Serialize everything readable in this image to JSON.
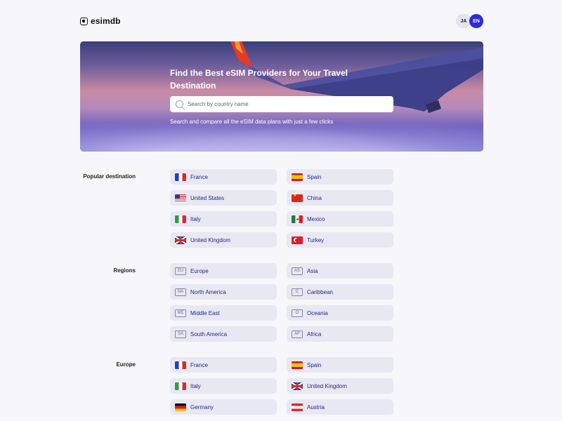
{
  "header": {
    "logo_text": "esimdb",
    "lang_options": [
      "JA",
      "EN"
    ],
    "active_lang": "EN"
  },
  "hero": {
    "title": "Find the Best eSIM Providers for Your Travel Destination",
    "search_placeholder": "Search by country name",
    "subtitle": "Search and compare all the eSIM data plans with just a few clicks"
  },
  "sections": {
    "popular": {
      "label": "Popular destination",
      "items": [
        {
          "label": "France",
          "icon": "flag-france"
        },
        {
          "label": "Spain",
          "icon": "flag-spain"
        },
        {
          "label": "United States",
          "icon": "flag-united-states"
        },
        {
          "label": "China",
          "icon": "flag-china"
        },
        {
          "label": "Italy",
          "icon": "flag-italy"
        },
        {
          "label": "Mexico",
          "icon": "flag-mexico"
        },
        {
          "label": "United Kingdom",
          "icon": "flag-united-kingdom"
        },
        {
          "label": "Turkey",
          "icon": "flag-turkey"
        }
      ]
    },
    "regions": {
      "label": "Regions",
      "items": [
        {
          "label": "Europe",
          "code": "EU"
        },
        {
          "label": "Asia",
          "code": "AS"
        },
        {
          "label": "North America",
          "code": "NA"
        },
        {
          "label": "Caribbean",
          "code": "C"
        },
        {
          "label": "Middle East",
          "code": "ME"
        },
        {
          "label": "Oceania",
          "code": "O"
        },
        {
          "label": "South America",
          "code": "SA"
        },
        {
          "label": "Africa",
          "code": "AF"
        }
      ]
    },
    "europe": {
      "label": "Europe",
      "items": [
        {
          "label": "France",
          "icon": "flag-france"
        },
        {
          "label": "Spain",
          "icon": "flag-spain"
        },
        {
          "label": "Italy",
          "icon": "flag-italy"
        },
        {
          "label": "United Kingdom",
          "icon": "flag-united-kingdom"
        },
        {
          "label": "Germany",
          "icon": "flag-germany"
        },
        {
          "label": "Austria",
          "icon": "flag-austria"
        }
      ]
    }
  },
  "colors": {
    "accent": "#2b2be0",
    "chip_bg": "#e8e8f2",
    "chip_text": "#1f1f8a",
    "page_bg": "#f6f6fb"
  }
}
